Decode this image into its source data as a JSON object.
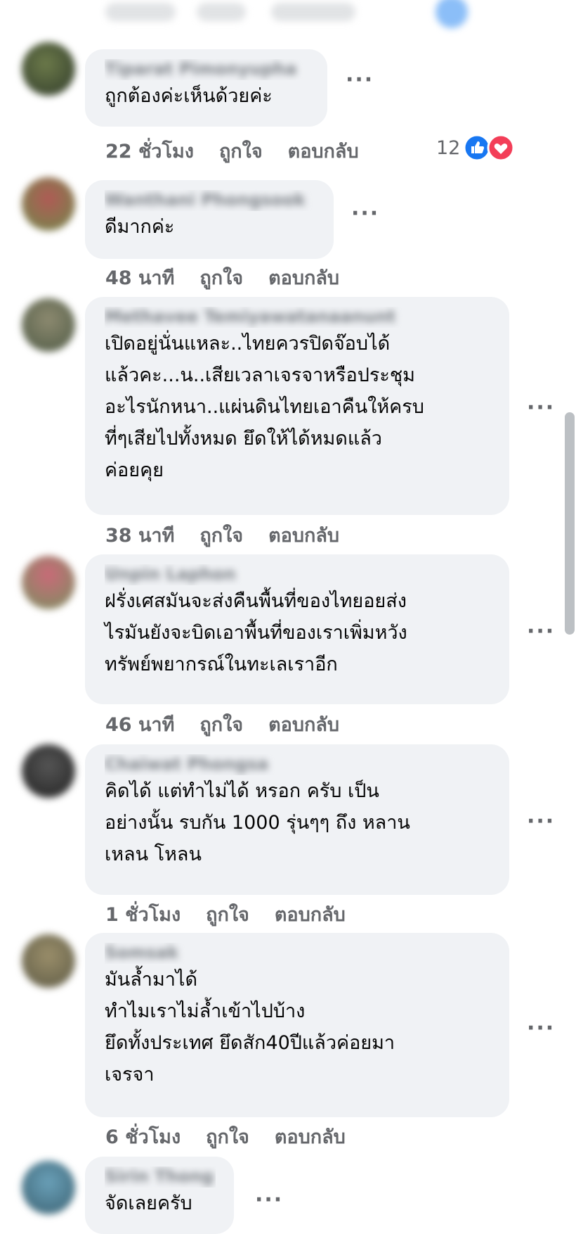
{
  "comments": [
    {
      "author": "Tiparat Pimonyupha",
      "text": "ถูกต้องค่ะเห็นด้วยค่ะ",
      "time": "22 ชั่วโมง",
      "like": "ถูกใจ",
      "reply": "ตอบกลับ",
      "reactions": "12"
    },
    {
      "author": "Wanthani Phongsook",
      "text": "ดีมากค่ะ",
      "time": "48 นาที",
      "like": "ถูกใจ",
      "reply": "ตอบกลับ"
    },
    {
      "author": "Methavee Temiyawatanaanunt",
      "text": "เปิดอยู่นั่นแหละ..ไทยควรปิดจ๊อบได้\nแล้วคะ...น..เสียเวลาเจรจาหรือประชุม\nอะไรนักหนา..แผ่นดินไทยเอาคืนให้ครบ\nที่ๆเสียไปทั้งหมด ยึดให้ได้หมดแล้ว\nค่อยคุย",
      "time": "38 นาที",
      "like": "ถูกใจ",
      "reply": "ตอบกลับ"
    },
    {
      "author": "Unpin Laphon",
      "text": "ฝรั่งเศสมันจะส่งคืนพื้นที่ของไทยอยส่ง\nไรมันยังจะบิดเอาพื้นที่ของเราเพิ่มหวัง\nทรัพย์พยากรณ์ในทะเลเราอีก",
      "time": "46 นาที",
      "like": "ถูกใจ",
      "reply": "ตอบกลับ"
    },
    {
      "author": "Chaiwat Phongsa",
      "text": "คิดได้ แต่ทำไม่ได้ หรอก ครับ เป็น\nอย่างนั้น รบกัน 1000 รุ่นๆๆ ถึง หลาน\nเหลน โหลน",
      "time": "1 ชั่วโมง",
      "like": "ถูกใจ",
      "reply": "ตอบกลับ"
    },
    {
      "author": "Somsak",
      "text": "มันล้ำมาได้\nทำไมเราไม่ล้ำเข้าไปบ้าง\nยึดทั้งประเทศ ยึดสัก40ปีแล้วค่อยมา\nเจรจา",
      "time": "6 ชั่วโมง",
      "like": "ถูกใจ",
      "reply": "ตอบกลับ"
    },
    {
      "author": "Sirin Thong",
      "text": "จัดเลยครับ"
    }
  ],
  "more_icon": "more-dots-icon",
  "reaction_icons": [
    "like-icon",
    "love-icon"
  ],
  "colors": {
    "bubble": "#f0f2f5",
    "meta": "#65676b",
    "like": "#1877f2",
    "love": "#f33e58"
  }
}
